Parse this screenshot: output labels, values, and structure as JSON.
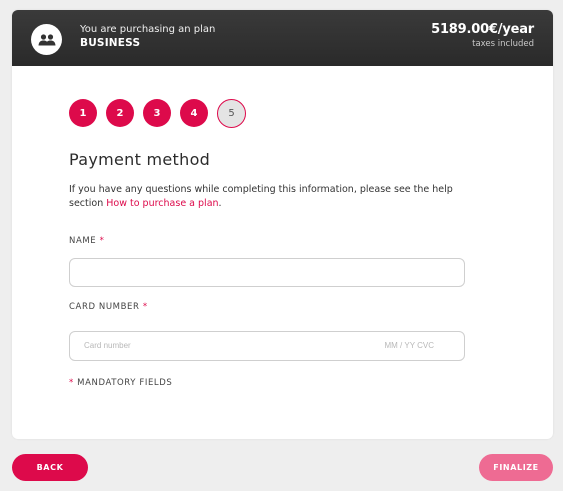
{
  "header": {
    "label": "You are purchasing an plan",
    "plan": "BUSINESS",
    "price": "5189.00€/year",
    "taxes": "taxes included",
    "icon": "users-icon"
  },
  "steps": [
    "1",
    "2",
    "3",
    "4",
    "5"
  ],
  "current_step": "5",
  "form": {
    "title": "Payment method",
    "help_text": "If you have any questions while completing this information, please see the help section ",
    "help_link": "How to purchase a plan",
    "help_suffix": ".",
    "name_label": "NAME",
    "name_value": "",
    "card_label": "CARD NUMBER",
    "required_marker": "*",
    "card_placeholder": "Card number",
    "card_expiry_cvc": "MM / YY  CVC",
    "mandatory_text": "MANDATORY FIELDS"
  },
  "buttons": {
    "back": "BACK",
    "finalize": "FINALIZE"
  },
  "colors": {
    "accent": "#dd0a4b",
    "accent_disabled": "#ee6b93",
    "header_bg": "#2f2f2f"
  }
}
